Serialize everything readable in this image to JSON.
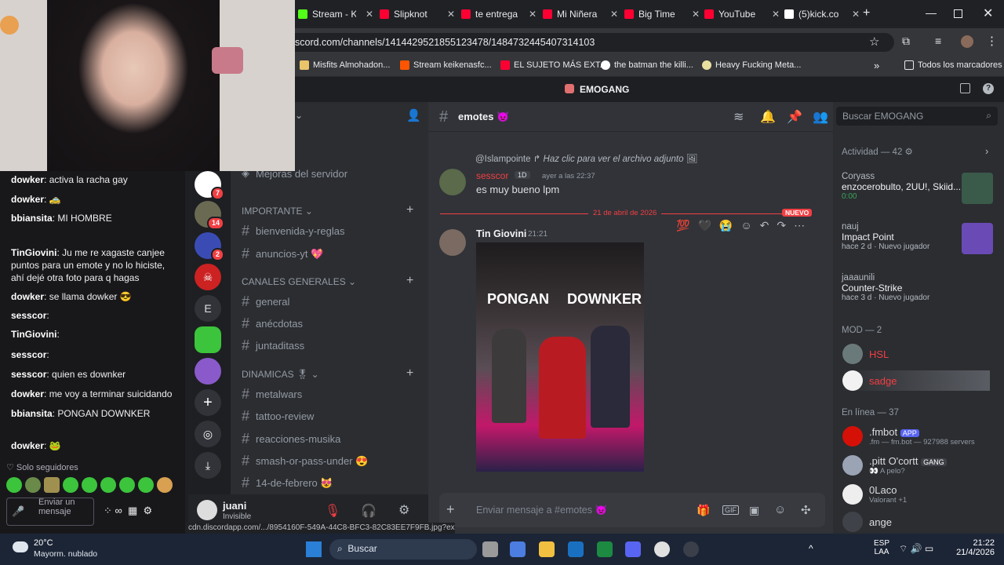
{
  "browser": {
    "tabs": [
      {
        "label": "Stream - K",
        "color": "#53fc18"
      },
      {
        "label": "Slipknot",
        "color": "#ff0033"
      },
      {
        "label": "te entrega",
        "color": "#ff0033"
      },
      {
        "label": "Mi Niñera",
        "color": "#ff0033"
      },
      {
        "label": "Big Time",
        "color": "#ff0033"
      },
      {
        "label": "YouTube",
        "color": "#ff0033"
      },
      {
        "label": "(5)kick.co",
        "color": "#ffffff"
      }
    ],
    "url": "scord.com/channels/1414429521855123478/1484732445407314103",
    "bookmarks": [
      "Misfits Almohadon...",
      "Stream keikenasfc...",
      "EL SUJETO MÁS EXT...",
      "the batman the killi...",
      "Heavy Fucking Meta..."
    ],
    "all_bookmarks": "Todos los marcadores",
    "tab_more": "»"
  },
  "discord": {
    "server_name": "EMOGANG",
    "server_badges": [
      "7",
      "14",
      "2"
    ],
    "server_letter": "E",
    "channels_top": "Mejoras del servidor",
    "categories": [
      {
        "name": "IMPORTANTE",
        "channels": [
          "bienvenida-y-reglas",
          "anuncios-yt 💖"
        ]
      },
      {
        "name": "CANALES GENERALES",
        "channels": [
          "general",
          "anécdotas",
          "juntaditass"
        ]
      },
      {
        "name": "DINAMICAS 🎖",
        "channels": [
          "metalwars",
          "tattoo-review",
          "reacciones-musika",
          "smash-or-pass-under 😍",
          "14-de-febrero 😻"
        ]
      }
    ],
    "user": {
      "name": "juani",
      "status": "Invisible"
    },
    "channel": {
      "name": "emotes 👿"
    },
    "search_placeholder": "Buscar EMOGANG",
    "messages": {
      "reply_to": "@Islampointe",
      "reply_text": "Haz clic para ver el archivo adjunto",
      "author1": "sesscor",
      "author1_badge": "1D",
      "time1": "ayer a las 22:37",
      "text1": "es muy bueno lpm",
      "divider": "21 de abril de 2026",
      "new_label": "NUEVO",
      "author2": "Tin Giovini",
      "time2": "21:21",
      "image_caption_left": "PONGAN",
      "image_caption_right": "DOWNKER"
    },
    "composer_placeholder": "Enviar mensaje a #emotes 👿",
    "members": {
      "activity_header": "Actividad — 42",
      "activities": [
        {
          "user": "Coryass",
          "title": "enzocerobulto, 2UU!, Skiid...",
          "sub": "0:00"
        },
        {
          "user": "nauj",
          "title": "Impact Point",
          "sub": "hace 2 d · Nuevo jugador"
        },
        {
          "user": "jaaaunili",
          "title": "Counter-Strike",
          "sub": "hace 3 d · Nuevo jugador"
        }
      ],
      "mod_header": "MOD — 2",
      "mods": [
        {
          "name": "HSL",
          "color": "#f23f43"
        },
        {
          "name": "sadge",
          "color": "#f23f43"
        }
      ],
      "online_header": "En línea — 37",
      "online": [
        {
          "name": ".fmbot",
          "tag": "APP",
          "sub": ".fm — fm.bot — 927988 servers"
        },
        {
          "name": ".pitt O'cortt",
          "tag": "GANG",
          "sub": "👀 A pelo?"
        },
        {
          "name": "0Laco",
          "tag": "",
          "sub": "Valorant +1"
        },
        {
          "name": "ange",
          "tag": "",
          "sub": ""
        }
      ]
    }
  },
  "stream_chat": {
    "lines": [
      {
        "name": "dowker",
        "text": "activa la racha gay"
      },
      {
        "name": "dowker",
        "text": "🚕"
      },
      {
        "name": "bbiansita",
        "text": "MI HOMBRE"
      },
      {
        "name": "TinGiovini",
        "text": "Ju me re xagaste canjee puntos para un emote y no lo hiciste, ahí dejé otra foto para q hagas"
      },
      {
        "name": "dowker",
        "text": "se llama dowker 😎"
      },
      {
        "name": "sesscor",
        "text": ""
      },
      {
        "name": "TinGiovini",
        "text": ""
      },
      {
        "name": "sesscor",
        "text": ""
      },
      {
        "name": "sesscor",
        "text": "quien es downker"
      },
      {
        "name": "dowker",
        "text": "me voy a terminar suicidando"
      },
      {
        "name": "bbiansita",
        "text": "PONGAN DOWNKER"
      },
      {
        "name": "dowker",
        "text": "🐸"
      }
    ],
    "followers_only": "Solo seguidores",
    "send_label": "Enviar un mensaje"
  },
  "status_url": "cdn.discordapp.com/.../8954160F-549A-44C8-BFC3-82C83EE7F9FB.jpg?ex=...",
  "taskbar": {
    "weather_temp": "20°C",
    "weather_desc": "Mayorm. nublado",
    "search": "Buscar",
    "lang": "ESP",
    "lang2": "LAA",
    "time": "21:22",
    "date": "21/4/2026"
  }
}
